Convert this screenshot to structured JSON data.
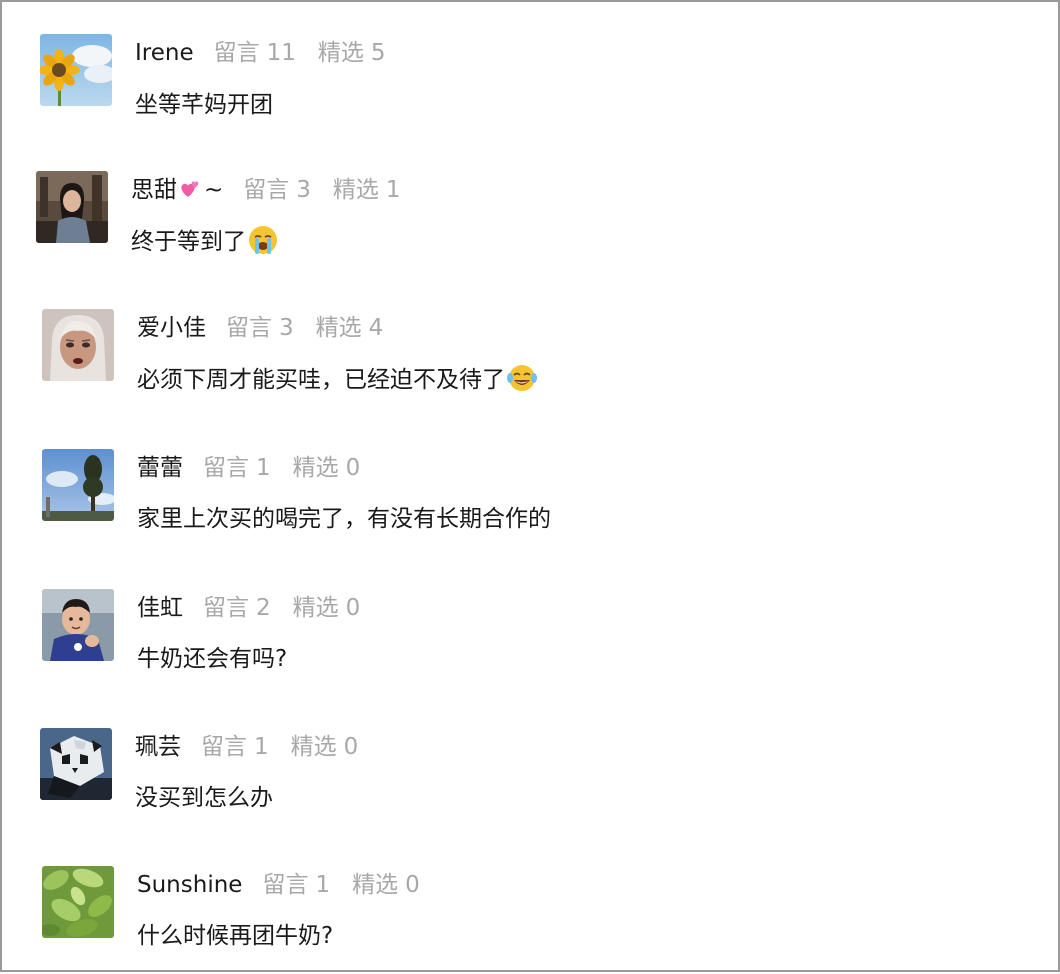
{
  "labels": {
    "comments_label": "留言",
    "featured_label": "精选"
  },
  "comments": [
    {
      "name": "Irene",
      "comments_count": "11",
      "featured_count": "5",
      "text": "坐等芊妈开团",
      "avatar_icon": "sunflower-sky-avatar"
    },
    {
      "name": "思甜",
      "name_suffix": "~",
      "name_emoji": "two-hearts-emoji",
      "comments_count": "3",
      "featured_count": "1",
      "text": "终于等到了",
      "text_emoji": "loudly-crying-face-emoji",
      "avatar_icon": "woman-portrait-avatar"
    },
    {
      "name": "爱小佳",
      "comments_count": "3",
      "featured_count": "4",
      "text": "必须下周才能买哇，已经迫不及待了",
      "text_emoji": "tears-of-joy-emoji",
      "avatar_icon": "illustrated-girl-avatar"
    },
    {
      "name": "蕾蕾",
      "comments_count": "1",
      "featured_count": "0",
      "text": "家里上次买的喝完了，有没有长期合作的",
      "avatar_icon": "tree-sky-avatar"
    },
    {
      "name": "佳虹",
      "comments_count": "2",
      "featured_count": "0",
      "text": "牛奶还会有吗?",
      "avatar_icon": "boy-photo-avatar"
    },
    {
      "name": "珮芸",
      "comments_count": "1",
      "featured_count": "0",
      "text": "没买到怎么办",
      "avatar_icon": "panda-sculpture-avatar"
    },
    {
      "name": "Sunshine",
      "comments_count": "1",
      "featured_count": "0",
      "text": "什么时候再团牛奶?",
      "avatar_icon": "green-leaves-avatar"
    }
  ]
}
